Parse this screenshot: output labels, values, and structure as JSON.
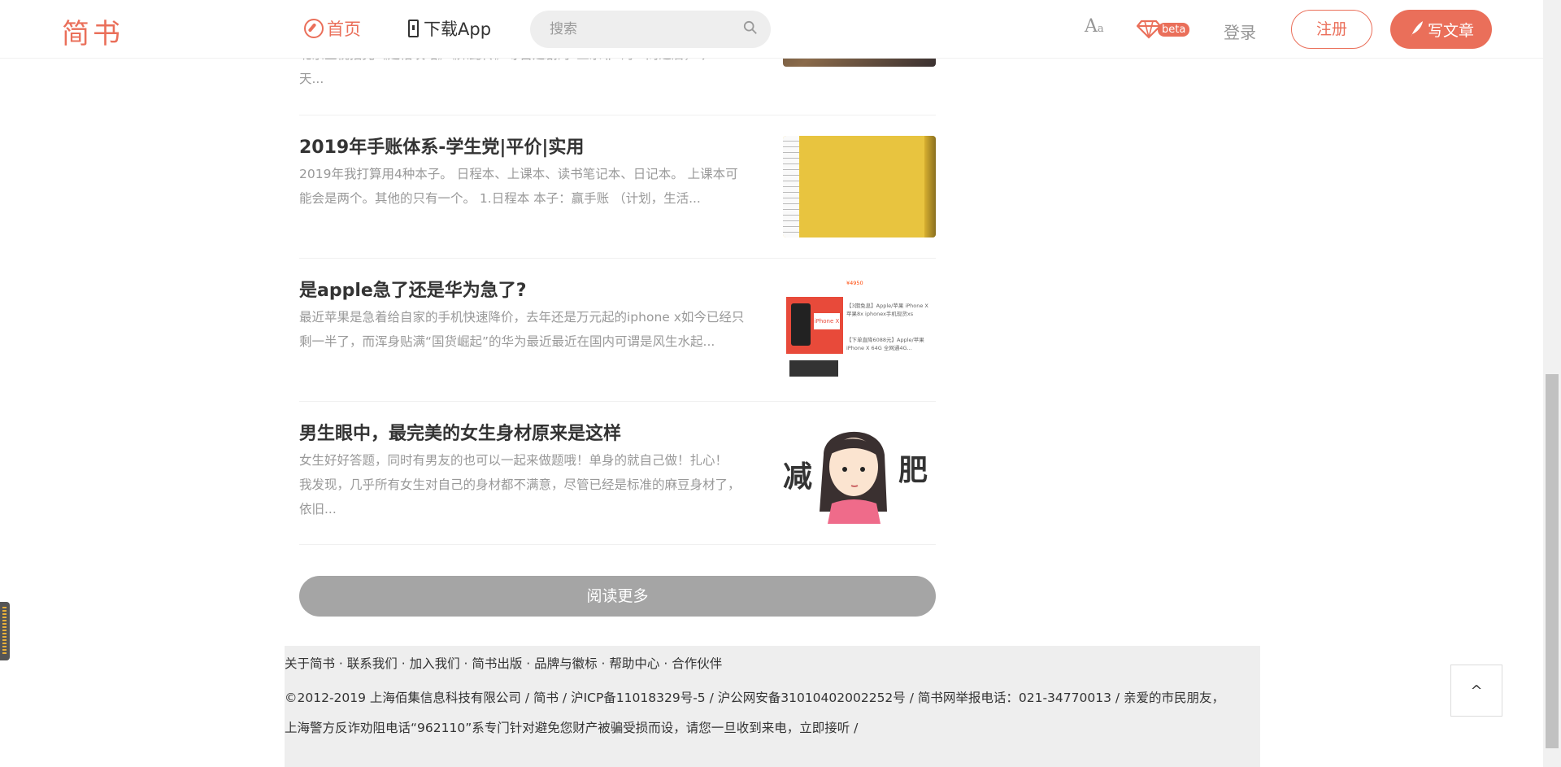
{
  "header": {
    "logo": "简书",
    "home": "首页",
    "download_app": "下载App",
    "search_placeholder": "搜索",
    "font_size_label": "A",
    "font_size_sub": "a",
    "beta": "beta",
    "login": "登录",
    "register": "注册",
    "write": "写文章",
    "accent_color": "#ea6f5a"
  },
  "articles": [
    {
      "title": "",
      "excerpt_line1": "北京卫视播完《延禧攻略》《如懿传》等宫廷剧的“五宗罪”的一周之后，今",
      "excerpt_line2": "天..."
    },
    {
      "title": "2019年手账体系-学生党|平价|实用",
      "excerpt_line1": "2019年我打算用4种本子。 日程本、上课本、读书笔记本、日记本。 上课本可",
      "excerpt_line2": "能会是两个。其他的只有一个。 1.日程本 本子：赢手账 （计划，生活..."
    },
    {
      "title": "是apple急了还是华为急了?",
      "excerpt_line1": "最近苹果是急着给自家的手机快速降价，去年还是万元起的iphone x如今已经只",
      "excerpt_line2": "剩一半了，而浑身贴满“国货崛起”的华为最近最近在国内可谓是风生水起..."
    },
    {
      "title": "男生眼中，最完美的女生身材原来是这样",
      "excerpt_line1": "女生好好答题，同时有男友的也可以一起来做题哦！单身的就自己做！扎心！",
      "excerpt_line2": "我发现，几乎所有女生对自己的身材都不满意，尽管已经是标准的麻豆身材了，",
      "excerpt_line3": "依旧..."
    }
  ],
  "thumb_texts": {
    "iphone_badge": "iPhone X",
    "iphone_price1": "¥4950",
    "iphone_text1": "【3期免息】Apple/苹果 iPhone X苹果8x iphonex手机现货xs",
    "iphone_text2": "【下单直降6088元】Apple/苹果 iPhone X 64G 全网通4G...",
    "girl_left": "减",
    "girl_right": "肥"
  },
  "read_more": "阅读更多",
  "footer": {
    "links": "关于简书 · 联系我们 · 加入我们 · 简书出版 · 品牌与徽标 · 帮助中心 · 合作伙伴",
    "copyright_line1": "©2012-2019 上海佰集信息科技有限公司 / 简书 / 沪ICP备11018329号-5 / 沪公网安备31010402002252号 / 简书网举报电话：021-34770013 / 亲爱的市民朋友，",
    "copyright_line2": "上海警方反诈劝阻电话“962110”系专门针对避免您财产被骗受损而设，请您一旦收到来电，立即接听 /"
  },
  "back_to_top": "^"
}
